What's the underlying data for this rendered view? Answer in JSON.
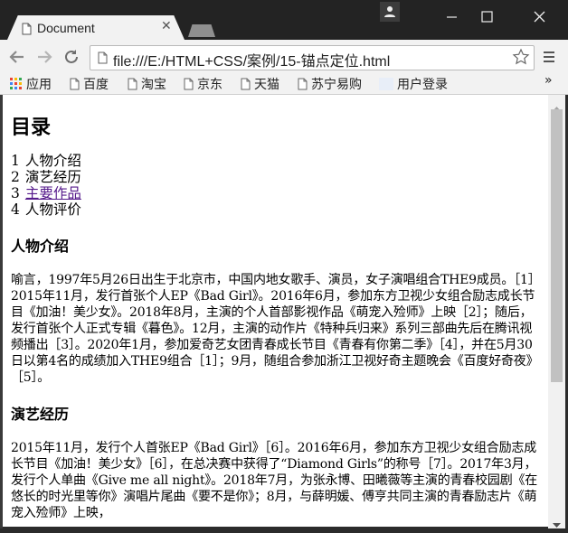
{
  "browser": {
    "tab_title": "Document",
    "url": "file:///E:/HTML+CSS/案例/15-锚点定位.html",
    "bookmarks": [
      {
        "label": "应用",
        "icon": "apps-grid-icon"
      },
      {
        "label": "百度",
        "icon": "folder-page-icon"
      },
      {
        "label": "淘宝",
        "icon": "folder-page-icon"
      },
      {
        "label": "京东",
        "icon": "folder-page-icon"
      },
      {
        "label": "天猫",
        "icon": "folder-page-icon"
      },
      {
        "label": "苏宁易购",
        "icon": "folder-page-icon"
      },
      {
        "label": "用户登录",
        "icon": "blank-favicon"
      }
    ],
    "bookmarks_more": "»"
  },
  "page": {
    "heading": "目录",
    "toc": [
      {
        "num": "1",
        "label": "人物介绍",
        "visited": false
      },
      {
        "num": "2",
        "label": "演艺经历",
        "visited": false
      },
      {
        "num": "3",
        "label": "主要作品",
        "visited": true
      },
      {
        "num": "4",
        "label": "人物评价",
        "visited": false
      }
    ],
    "sections": [
      {
        "title": "人物介绍",
        "text": "喻言，1997年5月26日出生于北京市，中国内地女歌手、演员，女子演唱组合THE9成员。［1］2015年11月，发行首张个人EP《Bad Girl》。2016年6月，参加东方卫视少女组合励志成长节目《加油！美少女》。2018年8月，主演的个人首部影视作品《萌宠入殓师》上映［2］；随后，发行首张个人正式专辑《暮色》。12月，主演的动作片《特种兵归来》系列三部曲先后在腾讯视频播出［3］。2020年1月，参加爱奇艺女团青春成长节目《青春有你第二季》［4］，并在5月30日以第4名的成绩加入THE9组合［1］；9月，随组合参加浙江卫视好奇主题晚会《百度好奇夜》［5］。"
      },
      {
        "title": "演艺经历",
        "text": "2015年11月，发行个人首张EP《Bad Girl》［6］。2016年6月，参加东方卫视少女组合励志成长节目《加油！美少女》［6］，在总决赛中获得了“Diamond Girls”的称号［7］。2017年3月，发行个人单曲《Give me all night》。2018年7月，为张永博、田曦薇等主演的青春校园剧《在悠长的时光里等你》演唱片尾曲《要不是你》；8月，与薛明媛、傅亨共同主演的青春励志片《萌宠入殓师》上映，"
      }
    ]
  }
}
